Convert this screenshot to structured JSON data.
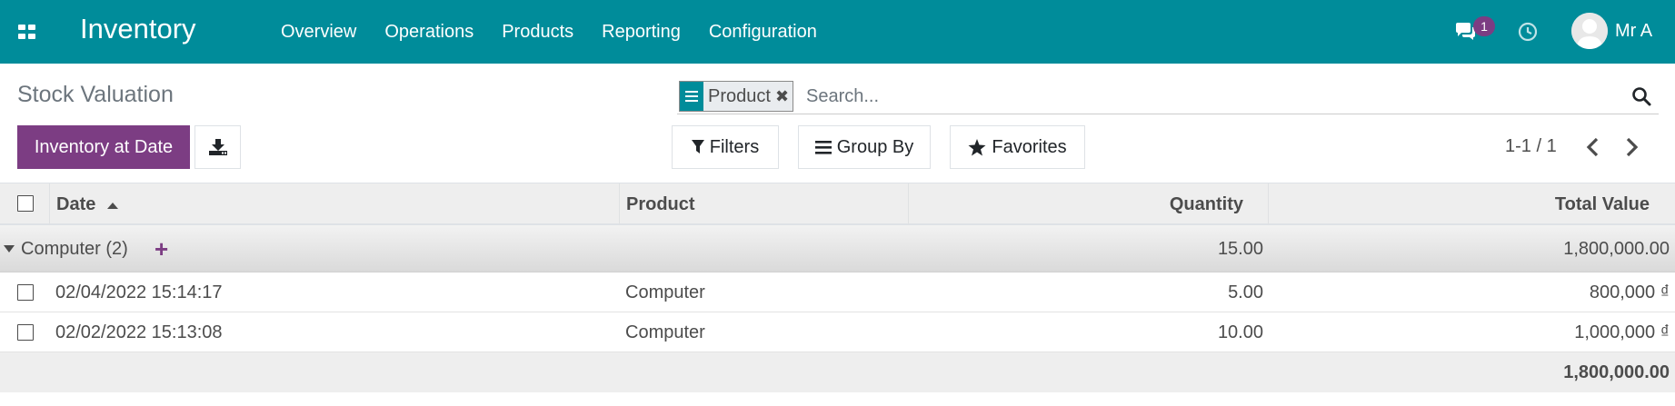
{
  "navbar": {
    "app_name": "Inventory",
    "menu": [
      {
        "label": "Overview"
      },
      {
        "label": "Operations"
      },
      {
        "label": "Products"
      },
      {
        "label": "Reporting"
      },
      {
        "label": "Configuration"
      }
    ],
    "message_count": "1",
    "user_name": "Mr A",
    "color": "#008c9a"
  },
  "control": {
    "title": "Stock Valuation",
    "facet": {
      "label": "Product",
      "icon": "group-by-icon"
    },
    "search_placeholder": "Search...",
    "primary_button": "Inventory at Date",
    "primary_color": "#7c3d83",
    "filters_label": "Filters",
    "groupby_label": "Group By",
    "favorites_label": "Favorites",
    "pager": "1-1 / 1"
  },
  "table": {
    "columns": [
      "Date",
      "Product",
      "Quantity",
      "Total Value"
    ],
    "group": {
      "label": "Computer (2)",
      "quantity": "15.00",
      "total": "1,800,000.00"
    },
    "rows": [
      {
        "date": "02/04/2022 15:14:17",
        "product": "Computer",
        "quantity": "5.00",
        "total": "800,000 ₫"
      },
      {
        "date": "02/02/2022 15:13:08",
        "product": "Computer",
        "quantity": "10.00",
        "total": "1,000,000 ₫"
      }
    ],
    "footer_total": "1,800,000.00"
  }
}
